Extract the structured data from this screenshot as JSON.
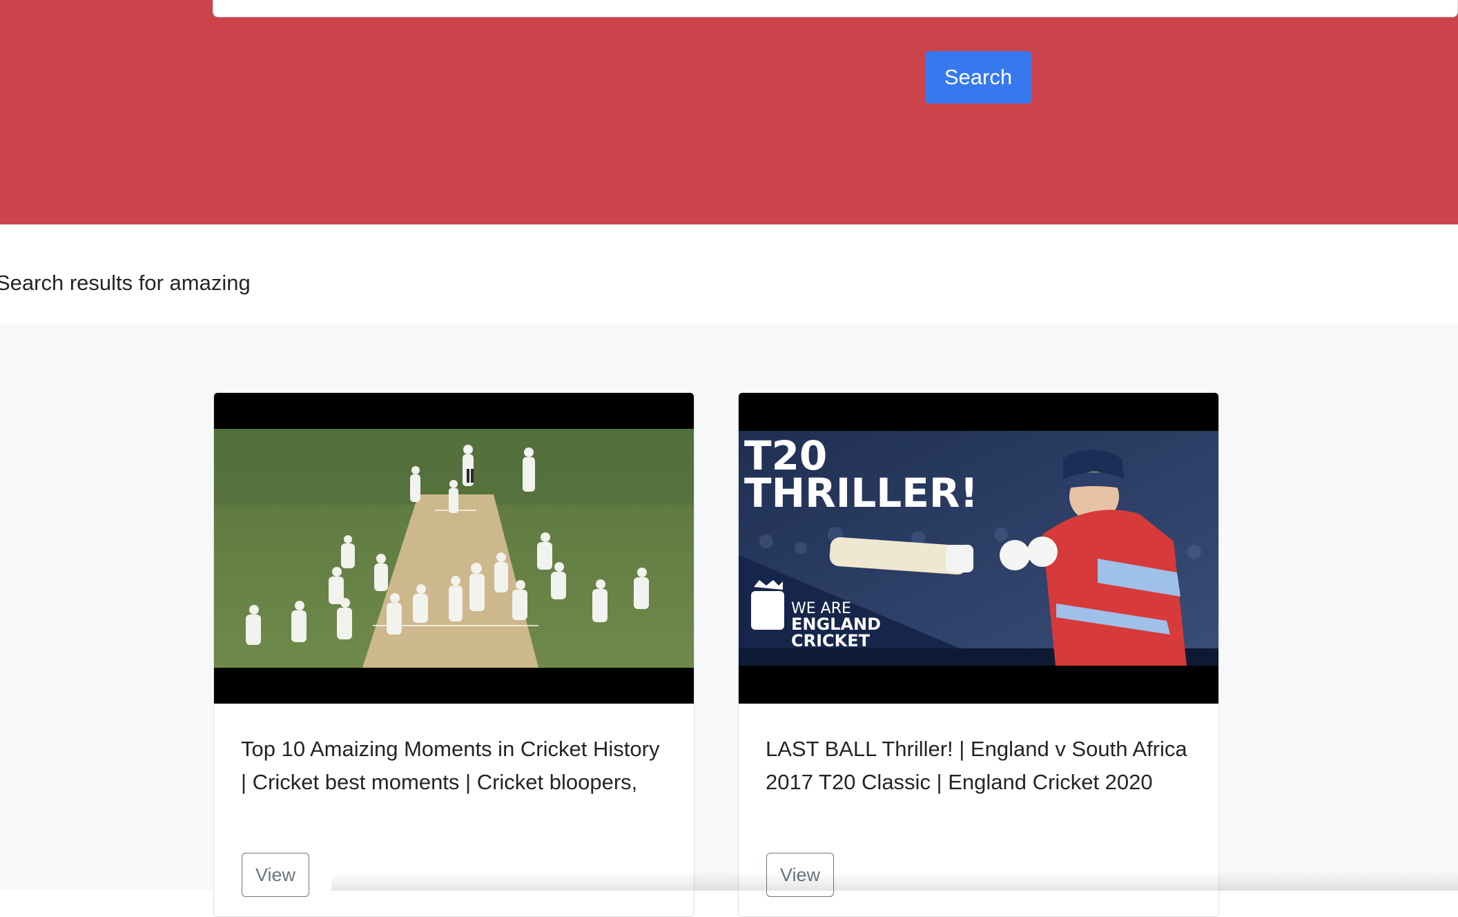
{
  "header": {
    "search_value": "",
    "search_button_label": "Search"
  },
  "results": {
    "heading": "Search results for amazing",
    "cards": [
      {
        "title": "Top 10 Amaizing Moments in Cricket History | Cricket best moments | Cricket bloopers,",
        "view_label": "View"
      },
      {
        "title": "LAST BALL Thriller! | England v South Africa 2017 T20 Classic | England Cricket 2020",
        "view_label": "View",
        "thumbnail_text": {
          "line1": "T20",
          "line2": "THRILLER!",
          "badge1": "WE ARE",
          "badge2": "ENGLAND",
          "badge3": "CRICKET"
        }
      }
    ]
  },
  "colors": {
    "hero_background": "#cc444b",
    "search_button": "#3679ef",
    "results_background": "#f7f8f9"
  }
}
